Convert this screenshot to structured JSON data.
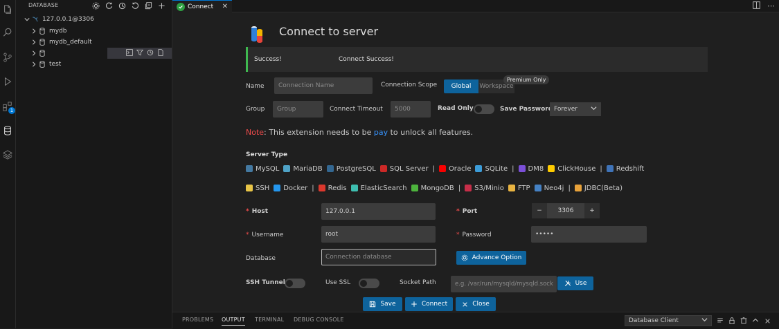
{
  "sidebar": {
    "title": "DATABASE",
    "connection": "127.0.0.1@3306",
    "items": [
      {
        "label": "mydb"
      },
      {
        "label": "mydb_default"
      },
      {
        "label": ""
      },
      {
        "label": "test"
      }
    ]
  },
  "activity": {
    "badge": "1"
  },
  "tab": {
    "label": "Connect"
  },
  "page": {
    "title": "Connect to server"
  },
  "alert": {
    "title": "Success!",
    "message": "Connect Success!"
  },
  "form": {
    "name_label": "Name",
    "name_placeholder": "Connection Name",
    "scope_label": "Connection Scope",
    "scope_global": "Global",
    "scope_workspace": "Workspace",
    "premium": "Premium Only",
    "group_label": "Group",
    "group_placeholder": "Group",
    "timeout_label": "Connect Timeout",
    "timeout_placeholder": "5000",
    "readonly_label": "Read Only",
    "savepw_label": "Save Password",
    "savepw_value": "Forever",
    "note_prefix": "Note",
    "note_text1": ": This extension needs to be ",
    "note_link": "pay",
    "note_text2": " to unlock all features.",
    "server_type_label": "Server Type",
    "host_label": "Host",
    "host_value": "127.0.0.1",
    "port_label": "Port",
    "port_value": "3306",
    "username_label": "Username",
    "username_value": "root",
    "password_label": "Password",
    "password_value": "•••••",
    "database_label": "Database",
    "database_placeholder": "Connection database",
    "advance_label": "Advance Option",
    "ssh_label": "SSH Tunnel",
    "ssl_label": "Use SSL",
    "socket_label": "Socket Path",
    "socket_placeholder": "e.g. /var/run/mysqld/mysqld.sock",
    "use_label": "Use",
    "save_label": "Save",
    "connect_label": "Connect",
    "close_label": "Close"
  },
  "server_types_row1": [
    {
      "label": "MySQL",
      "color": "#4479a1"
    },
    {
      "label": "MariaDB",
      "color": "#4fa3c7"
    },
    {
      "label": "PostgreSQL",
      "color": "#336791"
    },
    {
      "label": "SQL Server",
      "color": "#cc2927"
    },
    {
      "label": "Oracle",
      "color": "#f80000"
    },
    {
      "label": "SQLite",
      "color": "#3c9cd8"
    },
    {
      "label": "DM8",
      "color": "#7b4fd8"
    },
    {
      "label": "ClickHouse",
      "color": "#ffcc00"
    },
    {
      "label": "Redshift",
      "color": "#3f73b8"
    }
  ],
  "server_types_row2": [
    {
      "label": "SSH",
      "color": "#e8c547"
    },
    {
      "label": "Docker",
      "color": "#2496ed"
    },
    {
      "label": "Redis",
      "color": "#dc382d"
    },
    {
      "label": "ElasticSearch",
      "color": "#3ebeb0"
    },
    {
      "label": "MongoDB",
      "color": "#4db33d"
    },
    {
      "label": "S3/Minio",
      "color": "#c72e49"
    },
    {
      "label": "FTP",
      "color": "#e8b341"
    },
    {
      "label": "Neo4j",
      "color": "#4581c3"
    },
    {
      "label": "JDBC(Beta)",
      "color": "#e8a23a"
    }
  ],
  "panel": {
    "tabs": [
      "PROBLEMS",
      "OUTPUT",
      "TERMINAL",
      "DEBUG CONSOLE"
    ],
    "select_value": "Database Client"
  },
  "colors": {
    "accent": "#0e639c",
    "success": "#3fb950",
    "error": "#f14c4c",
    "link": "#3794ff"
  }
}
